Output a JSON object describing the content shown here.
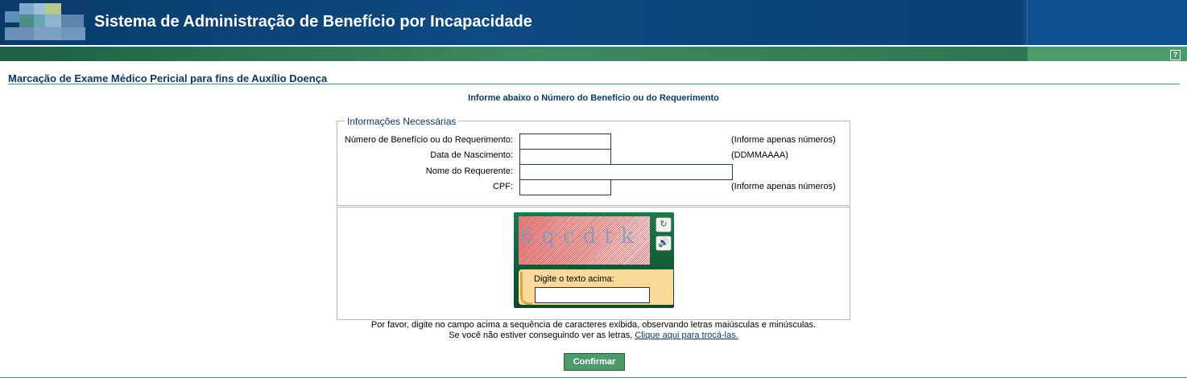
{
  "header": {
    "title": "Sistema de Administração de Benefício por Incapacidade",
    "help_icon": "help-icon",
    "colors": {
      "header_blue": "#0c3f73",
      "green_bar": "#3e8a62",
      "title_color": "#0c3866"
    }
  },
  "page": {
    "title": "Marcação de Exame Médico Pericial para fins de Auxílio Doença",
    "instruction": "Informe abaixo o Número do Benefício ou do Requerimento"
  },
  "form": {
    "legend": "Informações Necessárias",
    "fields": [
      {
        "label": "Número de Benefício ou do Requerimento:",
        "value": "",
        "hint": "(Informe apenas números)"
      },
      {
        "label": "Data de Nascimento:",
        "value": "",
        "hint": "(DDMMAAAA)"
      },
      {
        "label": "Nome do Requerente:",
        "value": "",
        "hint": ""
      },
      {
        "label": "CPF:",
        "value": "",
        "hint": "(Informe apenas números)"
      }
    ]
  },
  "captcha": {
    "text": "6qcdtk",
    "prompt": "Digite o texto acima:",
    "value": "",
    "refresh_icon": "refresh-icon",
    "audio_icon": "audio-icon"
  },
  "notes": {
    "line1": "Por favor, digite no campo acima a sequência de caracteres exibida, observando letras maiúsculas e minúsculas.",
    "line2_prefix": "Se você não estiver conseguindo ver as letras, ",
    "line2_link": "Clique aqui para trocá-las."
  },
  "actions": {
    "confirm_label": "Confirmar"
  }
}
